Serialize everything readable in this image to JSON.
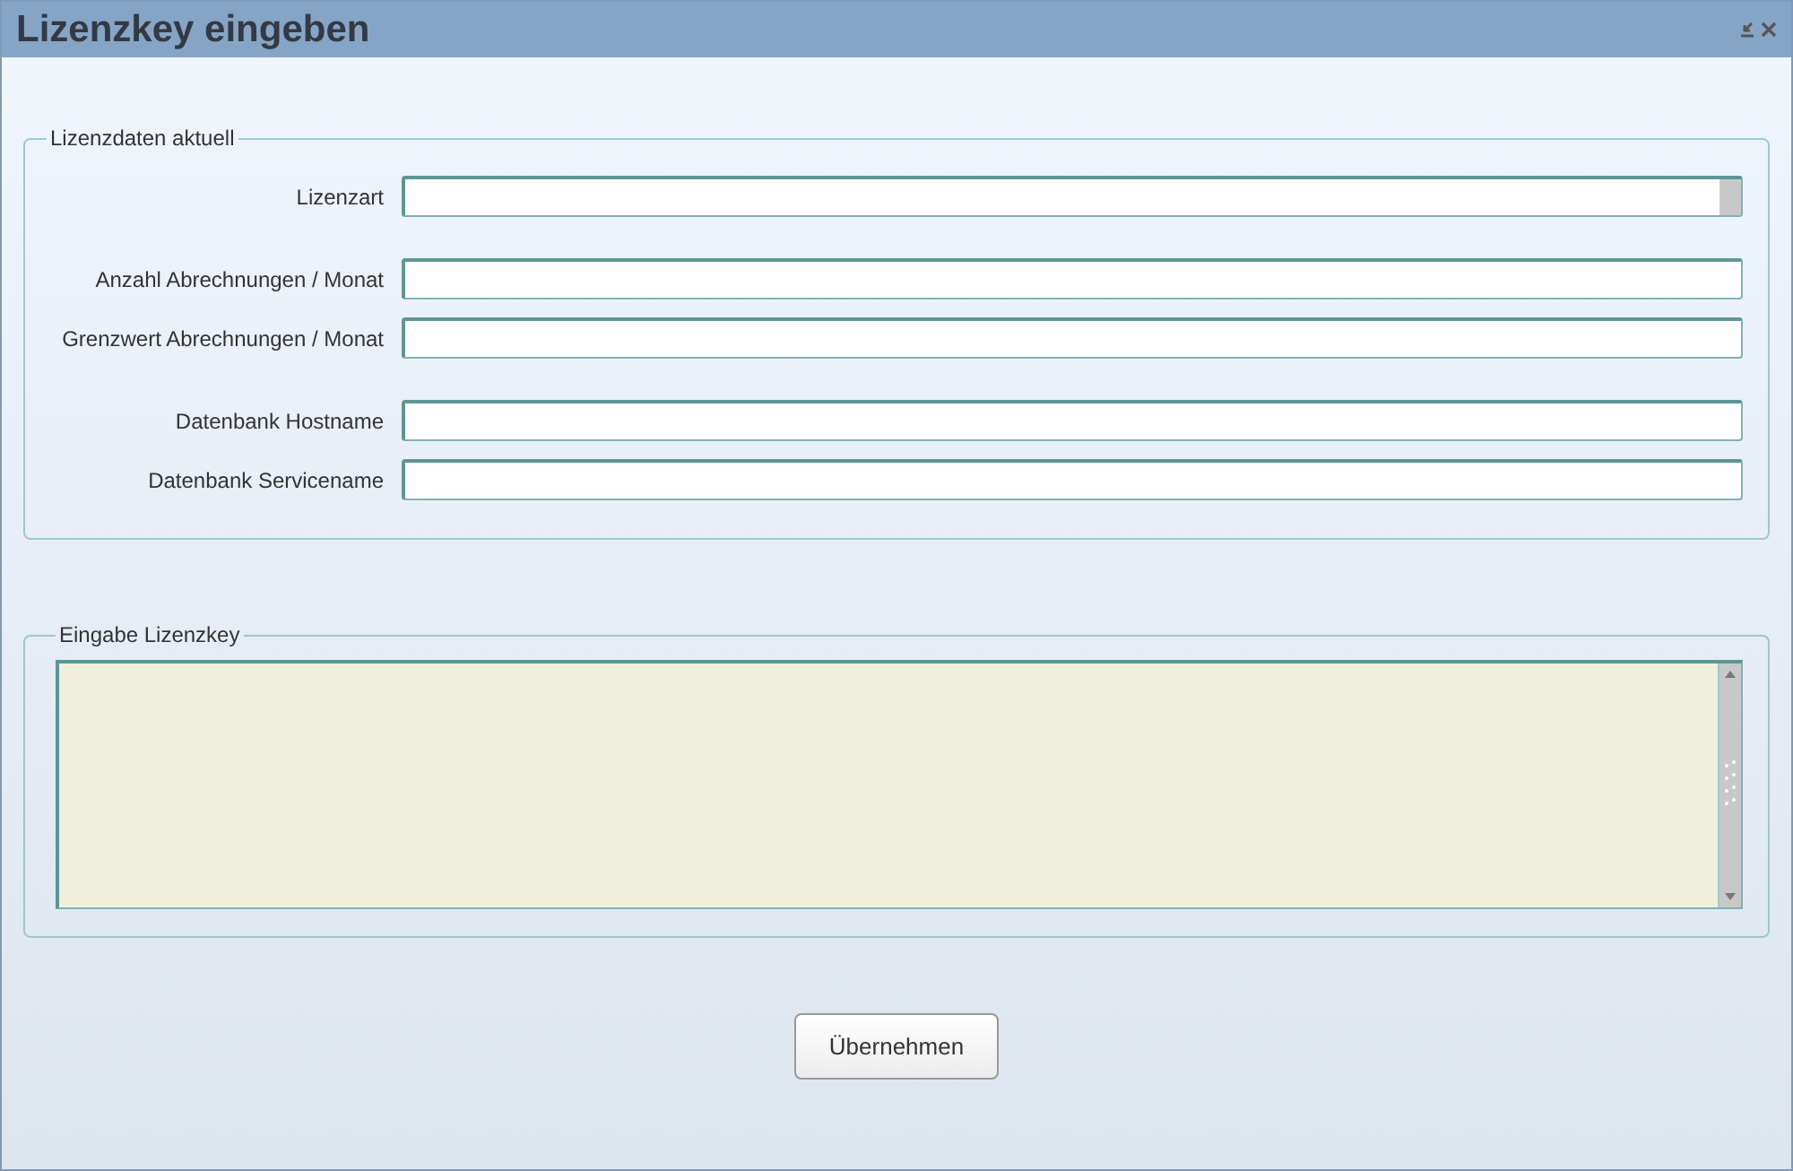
{
  "window": {
    "title": "Lizenzkey eingeben"
  },
  "license_data": {
    "legend": "Lizenzdaten aktuell",
    "groups": [
      [
        {
          "label": "Lizenzart",
          "kind": "select"
        }
      ],
      [
        {
          "label": "Anzahl Abrechnungen / Monat",
          "kind": "text"
        },
        {
          "label": "Grenzwert Abrechnungen / Monat",
          "kind": "text"
        }
      ],
      [
        {
          "label": "Datenbank Hostname",
          "kind": "text"
        },
        {
          "label": "Datenbank Servicename",
          "kind": "text"
        }
      ]
    ]
  },
  "key_entry": {
    "legend": "Eingabe Lizenzkey"
  },
  "buttons": [
    "Übernehmen"
  ]
}
